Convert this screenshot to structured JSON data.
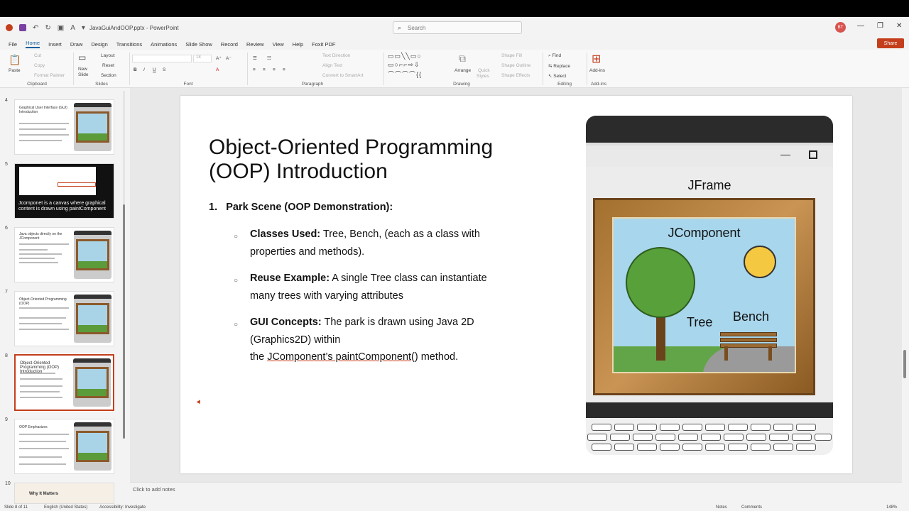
{
  "window": {
    "file_name": "JavaGuiAndOOP.pptx",
    "app_name": "PowerPoint",
    "separator": " - ",
    "search_placeholder": "Search",
    "user_initials": "BT",
    "share_label": "Share"
  },
  "menu": {
    "tabs": [
      "File",
      "Home",
      "Insert",
      "Draw",
      "Design",
      "Transitions",
      "Animations",
      "Slide Show",
      "Record",
      "Review",
      "View",
      "Help",
      "Foxit PDF"
    ],
    "active": "Home"
  },
  "ribbon": {
    "clipboard": {
      "label": "Clipboard",
      "paste": "Paste",
      "cut": "Cut",
      "copy": "Copy",
      "format_painter": "Format Painter"
    },
    "slides": {
      "label": "Slides",
      "new_slide": "New",
      "new_slide2": "Slide",
      "layout": "Layout",
      "reset": "Reset",
      "section": "Section"
    },
    "font": {
      "label": "Font",
      "size": "18"
    },
    "paragraph": {
      "label": "Paragraph",
      "text_direction": "Text Direction",
      "align_text": "Align Text",
      "smartart": "Convert to SmartArt"
    },
    "drawing": {
      "label": "Drawing",
      "arrange": "Arrange",
      "quick_styles": "Quick",
      "quick_styles2": "Styles",
      "shape_fill": "Shape Fill",
      "shape_outline": "Shape Outline",
      "shape_effects": "Shape Effects"
    },
    "editing": {
      "label": "Editing",
      "find": "Find",
      "replace": "Replace",
      "select": "Select"
    },
    "addins": {
      "label": "Add-ins",
      "addins_btn": "Add-ins"
    }
  },
  "thumbnails": [
    {
      "num": "4",
      "title": "Graphical User Interface (GUI) Introduction",
      "dark": false
    },
    {
      "num": "5",
      "title": "Jcomponet is a canvas where graphical content is drawn using paintComponent",
      "dark": true
    },
    {
      "num": "6",
      "title": "Java objects directly on the JComponent",
      "dark": false
    },
    {
      "num": "7",
      "title": "Object-Oriented Programming (OOP)",
      "dark": false
    },
    {
      "num": "8",
      "title": "Object-Oriented Programming (OOP) Introduction",
      "dark": false
    },
    {
      "num": "9",
      "title": "OOP Emphasizes",
      "dark": false
    },
    {
      "num": "10",
      "title": "Why It Matters",
      "dark": false
    }
  ],
  "slide": {
    "title": "Object-Oriented Programming (OOP) Introduction",
    "heading_num": "1.",
    "heading": "Park Scene (OOP Demonstration):",
    "bullets": [
      {
        "bold": "Classes Used:",
        "text": " Tree, Bench, (each as a class with properties and methods)."
      },
      {
        "bold": "Reuse Example:",
        "text": " A single Tree class can instantiate many trees with varying attributes"
      },
      {
        "bold": "GUI Concepts:",
        "text": " The park is drawn using Java 2D (Graphics2D) within"
      }
    ],
    "line3_prefix": "the ",
    "line3_link": "JComponent’s paintComponent",
    "line3_suffix": "() method.",
    "illustration": {
      "jframe": "JFrame",
      "jcomponent": "JComponent",
      "tree": "Tree",
      "bench": "Bench"
    }
  },
  "notes_placeholder": "Click to add notes",
  "status": {
    "slide_info": "Slide 8 of 11",
    "language": "English (United States)",
    "accessibility": "Accessibility: Investigate",
    "notes_btn": "Notes",
    "comments_btn": "Comments",
    "zoom": "148%"
  }
}
